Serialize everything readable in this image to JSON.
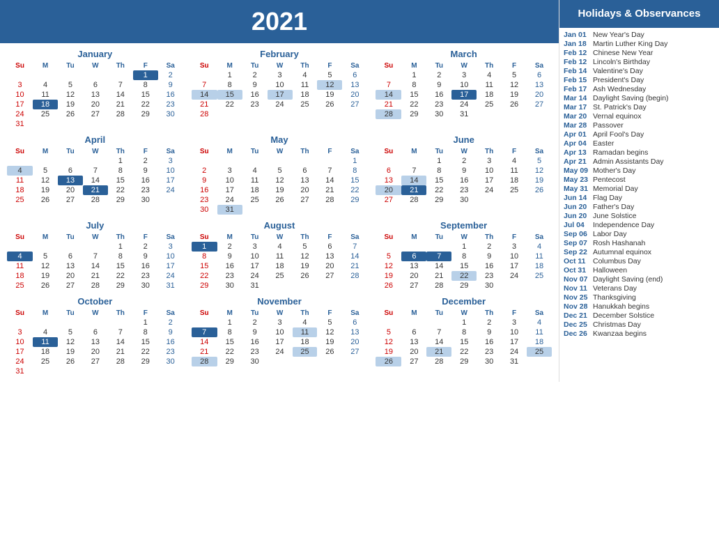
{
  "header": {
    "year": "2021",
    "sidebar_title": "Holidays & Observances"
  },
  "months": [
    {
      "name": "January",
      "days_header": [
        "Su",
        "M",
        "Tu",
        "W",
        "Th",
        "F",
        "Sa"
      ],
      "weeks": [
        [
          "",
          "",
          "",
          "",
          "",
          "1",
          "2"
        ],
        [
          "3",
          "4",
          "5",
          "6",
          "7",
          "8",
          "9"
        ],
        [
          "10",
          "11",
          "12",
          "13",
          "14",
          "15",
          "16"
        ],
        [
          "17",
          "18",
          "19",
          "20",
          "21",
          "22",
          "23"
        ],
        [
          "24",
          "25",
          "26",
          "27",
          "28",
          "29",
          "30"
        ],
        [
          "31",
          "",
          "",
          "",
          "",
          "",
          ""
        ]
      ],
      "highlights": {
        "1": "blue",
        "18": "blue"
      }
    },
    {
      "name": "February",
      "days_header": [
        "Su",
        "M",
        "Tu",
        "W",
        "Th",
        "F",
        "Sa"
      ],
      "weeks": [
        [
          "",
          "1",
          "2",
          "3",
          "4",
          "5",
          "6"
        ],
        [
          "7",
          "8",
          "9",
          "10",
          "11",
          "12",
          "13"
        ],
        [
          "14",
          "15",
          "16",
          "17",
          "18",
          "19",
          "20"
        ],
        [
          "21",
          "22",
          "23",
          "24",
          "25",
          "26",
          "27"
        ],
        [
          "28",
          "",
          "",
          "",
          "",
          "",
          ""
        ]
      ],
      "highlights": {
        "12": "light",
        "14": "light",
        "15": "light",
        "17": "light"
      }
    },
    {
      "name": "March",
      "days_header": [
        "Su",
        "M",
        "Tu",
        "W",
        "Th",
        "F",
        "Sa"
      ],
      "weeks": [
        [
          "",
          "1",
          "2",
          "3",
          "4",
          "5",
          "6"
        ],
        [
          "7",
          "8",
          "9",
          "10",
          "11",
          "12",
          "13"
        ],
        [
          "14",
          "15",
          "16",
          "17",
          "18",
          "19",
          "20"
        ],
        [
          "21",
          "22",
          "23",
          "24",
          "25",
          "26",
          "27"
        ],
        [
          "28",
          "29",
          "30",
          "31",
          "",
          "",
          ""
        ]
      ],
      "highlights": {
        "6": "sat",
        "13": "sat",
        "17": "blue",
        "20": "sat",
        "27": "sat",
        "14": "light",
        "28": "light"
      }
    },
    {
      "name": "April",
      "days_header": [
        "Su",
        "M",
        "Tu",
        "W",
        "Th",
        "F",
        "Sa"
      ],
      "weeks": [
        [
          "",
          "",
          "",
          "",
          "1",
          "2",
          "3"
        ],
        [
          "4",
          "5",
          "6",
          "7",
          "8",
          "9",
          "10"
        ],
        [
          "11",
          "12",
          "13",
          "14",
          "15",
          "16",
          "17"
        ],
        [
          "18",
          "19",
          "20",
          "21",
          "22",
          "23",
          "24"
        ],
        [
          "25",
          "26",
          "27",
          "28",
          "29",
          "30",
          ""
        ]
      ],
      "highlights": {
        "4": "light",
        "13": "blue",
        "21": "blue"
      }
    },
    {
      "name": "May",
      "days_header": [
        "Su",
        "M",
        "Tu",
        "W",
        "Th",
        "F",
        "Sa"
      ],
      "weeks": [
        [
          "",
          "",
          "",
          "",
          "",
          "",
          "1"
        ],
        [
          "2",
          "3",
          "4",
          "5",
          "6",
          "7",
          "8"
        ],
        [
          "9",
          "10",
          "11",
          "12",
          "13",
          "14",
          "15"
        ],
        [
          "16",
          "17",
          "18",
          "19",
          "20",
          "21",
          "22"
        ],
        [
          "23",
          "24",
          "25",
          "26",
          "27",
          "28",
          "29"
        ],
        [
          "30",
          "31",
          "",
          "",
          "",
          "",
          ""
        ]
      ],
      "highlights": {
        "31": "light"
      }
    },
    {
      "name": "June",
      "days_header": [
        "Su",
        "M",
        "Tu",
        "W",
        "Th",
        "F",
        "Sa"
      ],
      "weeks": [
        [
          "",
          "",
          "1",
          "2",
          "3",
          "4",
          "5"
        ],
        [
          "6",
          "7",
          "8",
          "9",
          "10",
          "11",
          "12"
        ],
        [
          "13",
          "14",
          "15",
          "16",
          "17",
          "18",
          "19"
        ],
        [
          "20",
          "21",
          "22",
          "23",
          "24",
          "25",
          "26"
        ],
        [
          "27",
          "28",
          "29",
          "30",
          "",
          "",
          ""
        ]
      ],
      "highlights": {
        "5": "sat",
        "12": "sat",
        "19": "sat",
        "26": "sat",
        "14": "light",
        "20": "light",
        "21": "blue"
      }
    },
    {
      "name": "July",
      "days_header": [
        "Su",
        "M",
        "Tu",
        "W",
        "Th",
        "F",
        "Sa"
      ],
      "weeks": [
        [
          "",
          "",
          "",
          "",
          "1",
          "2",
          "3"
        ],
        [
          "4",
          "5",
          "6",
          "7",
          "8",
          "9",
          "10"
        ],
        [
          "11",
          "12",
          "13",
          "14",
          "15",
          "16",
          "17"
        ],
        [
          "18",
          "19",
          "20",
          "21",
          "22",
          "23",
          "24"
        ],
        [
          "25",
          "26",
          "27",
          "28",
          "29",
          "30",
          "31"
        ]
      ],
      "highlights": {
        "3": "sat",
        "4": "blue",
        "10": "sat",
        "17": "sat",
        "24": "sat",
        "31": "sat"
      }
    },
    {
      "name": "August",
      "days_header": [
        "Su",
        "M",
        "Tu",
        "W",
        "Th",
        "F",
        "Sa"
      ],
      "weeks": [
        [
          "1",
          "2",
          "3",
          "4",
          "5",
          "6",
          "7"
        ],
        [
          "8",
          "9",
          "10",
          "11",
          "12",
          "13",
          "14"
        ],
        [
          "15",
          "16",
          "17",
          "18",
          "19",
          "20",
          "21"
        ],
        [
          "22",
          "23",
          "24",
          "25",
          "26",
          "27",
          "28"
        ],
        [
          "29",
          "30",
          "31",
          "",
          "",
          "",
          ""
        ]
      ],
      "highlights": {
        "1": "blue",
        "7": "sat",
        "14": "sat",
        "21": "sat",
        "28": "sat"
      }
    },
    {
      "name": "September",
      "days_header": [
        "Su",
        "M",
        "Tu",
        "W",
        "Th",
        "F",
        "Sa"
      ],
      "weeks": [
        [
          "",
          "",
          "",
          "1",
          "2",
          "3",
          "4"
        ],
        [
          "5",
          "6",
          "7",
          "8",
          "9",
          "10",
          "11"
        ],
        [
          "12",
          "13",
          "14",
          "15",
          "16",
          "17",
          "18"
        ],
        [
          "19",
          "20",
          "21",
          "22",
          "23",
          "24",
          "25"
        ],
        [
          "26",
          "27",
          "28",
          "29",
          "30",
          "",
          ""
        ]
      ],
      "highlights": {
        "4": "sat",
        "6": "blue",
        "7": "blue",
        "11": "sat",
        "18": "sat",
        "25": "sat",
        "22": "light"
      }
    },
    {
      "name": "October",
      "days_header": [
        "Su",
        "M",
        "Tu",
        "W",
        "Th",
        "F",
        "Sa"
      ],
      "weeks": [
        [
          "",
          "",
          "",
          "",
          "",
          "1",
          "2"
        ],
        [
          "3",
          "4",
          "5",
          "6",
          "7",
          "8",
          "9"
        ],
        [
          "10",
          "11",
          "12",
          "13",
          "14",
          "15",
          "16"
        ],
        [
          "17",
          "18",
          "19",
          "20",
          "21",
          "22",
          "23"
        ],
        [
          "24",
          "25",
          "26",
          "27",
          "28",
          "29",
          "30"
        ],
        [
          "31",
          "",
          "",
          "",
          "",
          "",
          ""
        ]
      ],
      "highlights": {
        "2": "sat",
        "9": "sat",
        "11": "blue",
        "16": "sat",
        "23": "sat",
        "30": "sat"
      }
    },
    {
      "name": "November",
      "days_header": [
        "Su",
        "M",
        "Tu",
        "W",
        "Th",
        "F",
        "Sa"
      ],
      "weeks": [
        [
          "",
          "1",
          "2",
          "3",
          "4",
          "5",
          "6"
        ],
        [
          "7",
          "8",
          "9",
          "10",
          "11",
          "12",
          "13"
        ],
        [
          "14",
          "15",
          "16",
          "17",
          "18",
          "19",
          "20"
        ],
        [
          "21",
          "22",
          "23",
          "24",
          "25",
          "26",
          "27"
        ],
        [
          "28",
          "29",
          "30",
          "",
          "",
          "",
          ""
        ]
      ],
      "highlights": {
        "6": "sat",
        "7": "blue",
        "11": "light",
        "13": "sat",
        "20": "sat",
        "25": "light",
        "27": "sat",
        "28": "light"
      }
    },
    {
      "name": "December",
      "days_header": [
        "Su",
        "M",
        "Tu",
        "W",
        "Th",
        "F",
        "Sa"
      ],
      "weeks": [
        [
          "",
          "",
          "",
          "1",
          "2",
          "3",
          "4"
        ],
        [
          "5",
          "6",
          "7",
          "8",
          "9",
          "10",
          "11"
        ],
        [
          "12",
          "13",
          "14",
          "15",
          "16",
          "17",
          "18"
        ],
        [
          "19",
          "20",
          "21",
          "22",
          "23",
          "24",
          "25"
        ],
        [
          "26",
          "27",
          "28",
          "29",
          "30",
          "31",
          ""
        ]
      ],
      "highlights": {
        "4": "sat",
        "11": "sat",
        "18": "sat",
        "21": "light",
        "25": "light",
        "26": "light"
      }
    }
  ],
  "holidays": [
    {
      "date": "Jan 01",
      "name": "New Year's Day",
      "bold": false
    },
    {
      "date": "Jan 18",
      "name": "Martin Luther King Day",
      "bold": true
    },
    {
      "date": "Feb 12",
      "name": "Chinese New Year",
      "bold": false
    },
    {
      "date": "Feb 12",
      "name": "Lincoln's Birthday",
      "bold": false
    },
    {
      "date": "Feb 14",
      "name": "Valentine's Day",
      "bold": false
    },
    {
      "date": "Feb 15",
      "name": "President's Day",
      "bold": false
    },
    {
      "date": "Feb 17",
      "name": "Ash Wednesday",
      "bold": false
    },
    {
      "date": "Mar 14",
      "name": "Daylight Saving (begin)",
      "bold": false
    },
    {
      "date": "Mar 17",
      "name": "St. Patrick's Day",
      "bold": false
    },
    {
      "date": "Mar 20",
      "name": "Vernal equinox",
      "bold": false
    },
    {
      "date": "Mar 28",
      "name": "Passover",
      "bold": false
    },
    {
      "date": "Apr 01",
      "name": "April Fool's Day",
      "bold": false
    },
    {
      "date": "Apr 04",
      "name": "Easter",
      "bold": false
    },
    {
      "date": "Apr 13",
      "name": "Ramadan begins",
      "bold": false
    },
    {
      "date": "Apr 21",
      "name": "Admin Assistants Day",
      "bold": false
    },
    {
      "date": "May 09",
      "name": "Mother's Day",
      "bold": false
    },
    {
      "date": "May 23",
      "name": "Pentecost",
      "bold": false
    },
    {
      "date": "May 31",
      "name": "Memorial Day",
      "bold": true
    },
    {
      "date": "Jun 14",
      "name": "Flag Day",
      "bold": false
    },
    {
      "date": "Jun 20",
      "name": "Father's Day",
      "bold": false
    },
    {
      "date": "Jun 20",
      "name": "June Solstice",
      "bold": false
    },
    {
      "date": "Jul 04",
      "name": "Independence Day",
      "bold": true
    },
    {
      "date": "Sep 06",
      "name": "Labor Day",
      "bold": true
    },
    {
      "date": "Sep 07",
      "name": "Rosh Hashanah",
      "bold": false
    },
    {
      "date": "Sep 22",
      "name": "Autumnal equinox",
      "bold": false
    },
    {
      "date": "Oct 11",
      "name": "Columbus Day",
      "bold": true
    },
    {
      "date": "Oct 31",
      "name": "Halloween",
      "bold": false
    },
    {
      "date": "Nov 07",
      "name": "Daylight Saving (end)",
      "bold": false
    },
    {
      "date": "Nov 11",
      "name": "Veterans Day",
      "bold": true
    },
    {
      "date": "Nov 25",
      "name": "Thanksgiving",
      "bold": true
    },
    {
      "date": "Nov 28",
      "name": "Hanukkah begins",
      "bold": false
    },
    {
      "date": "Dec 21",
      "name": "December Solstice",
      "bold": false
    },
    {
      "date": "Dec 25",
      "name": "Christmas Day",
      "bold": true
    },
    {
      "date": "Dec 26",
      "name": "Kwanzaa begins",
      "bold": false
    }
  ]
}
